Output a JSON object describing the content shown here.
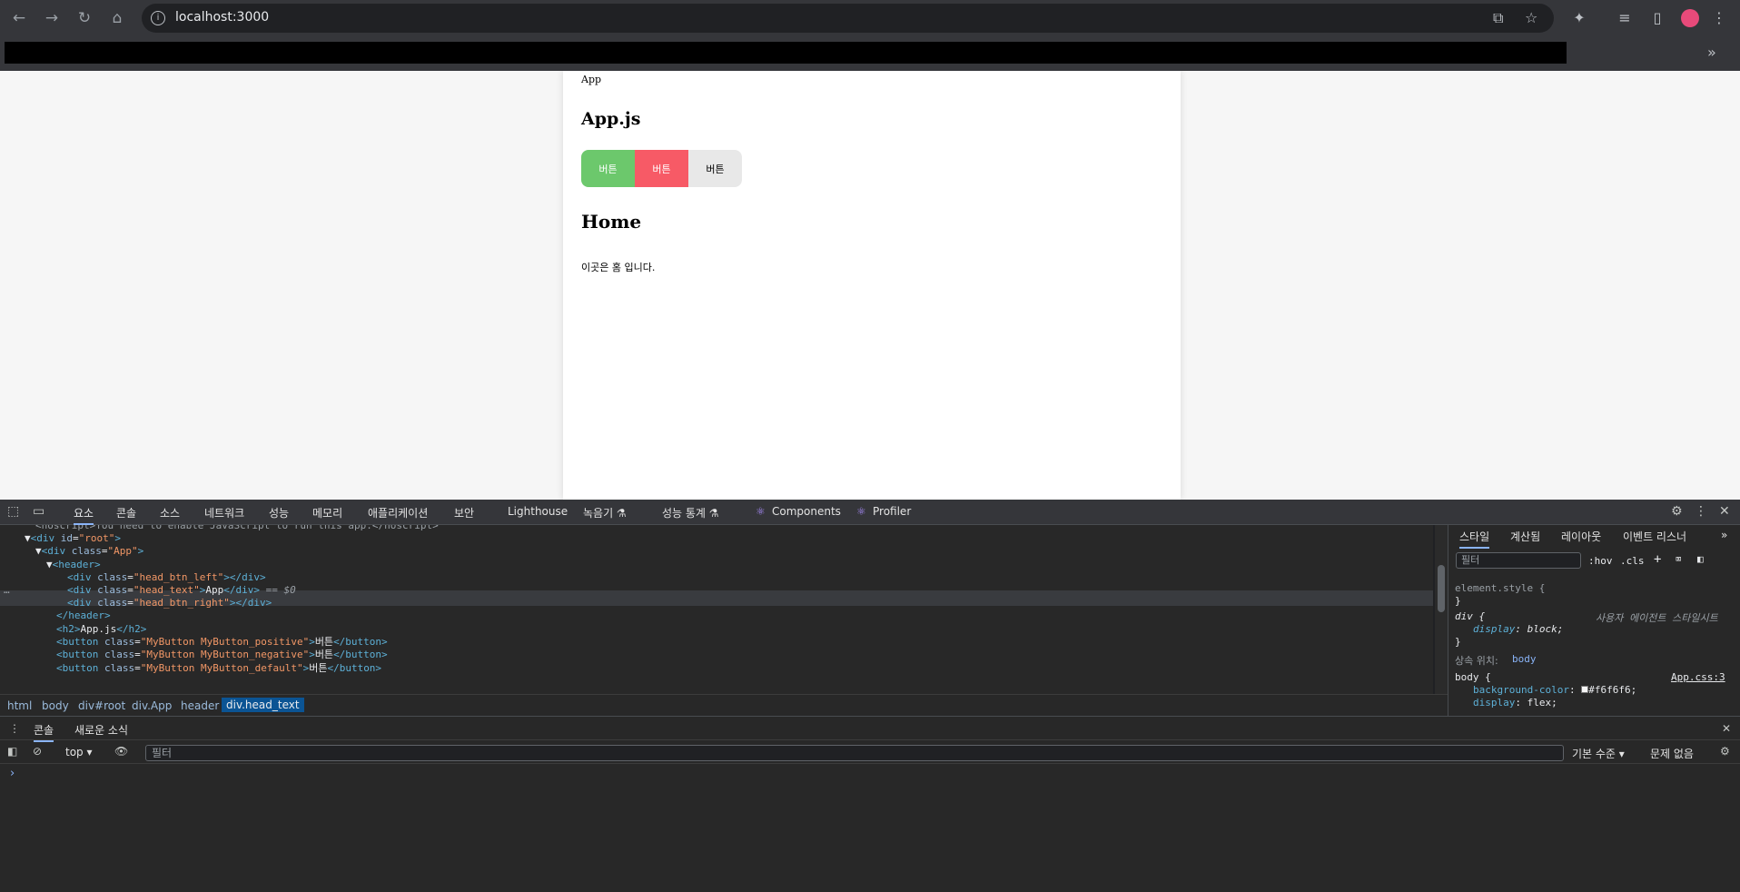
{
  "browser": {
    "url": "localhost:3000",
    "icons": [
      "back-icon",
      "forward-icon",
      "reload-icon",
      "home-icon",
      "info-icon",
      "install-icon",
      "star-icon",
      "extensions-icon",
      "media-icon",
      "sidepanel-icon",
      "profile-avatar",
      "menu-icon"
    ]
  },
  "page": {
    "head_text": "App",
    "title": "App.js",
    "buttons": [
      "버튼",
      "버튼",
      "버튼"
    ],
    "home_title": "Home",
    "home_text": "이곳은 홈 입니다."
  },
  "colors": {
    "positive": "#6cc86c",
    "negative": "#f75a66",
    "default": "#e8e8e8",
    "page_bg": "#f6f6f6",
    "devtools_bg": "#282828",
    "accent": "#8ab4f8"
  },
  "devtools": {
    "tabs": [
      "요소",
      "콘솔",
      "소스",
      "네트워크",
      "성능",
      "메모리",
      "애플리케이션",
      "보안",
      "Lighthouse",
      "녹음기 ⚗",
      "성능 통계 ⚗",
      "Components",
      "Profiler"
    ],
    "tree": {
      "cut": "<noscript>You need to enable JavaScript to run this app.</noscript>",
      "root": {
        "tag": "div",
        "attr": "id",
        "val": "root"
      },
      "app": {
        "tag": "div",
        "attr": "class",
        "val": "App"
      },
      "header": "header",
      "left": {
        "tag": "div",
        "attr": "class",
        "val": "head_btn_left"
      },
      "text": {
        "tag": "div",
        "attr": "class",
        "val": "head_text",
        "content": "App",
        "marker": "== $0"
      },
      "right": {
        "tag": "div",
        "attr": "class",
        "val": "head_btn_right"
      },
      "header_close": "/header",
      "h2": {
        "tag": "h2",
        "content": "App.js"
      },
      "b1": {
        "tag": "button",
        "attr": "class",
        "val": "MyButton MyButton_positive",
        "content": "버튼"
      },
      "b2": {
        "tag": "button",
        "attr": "class",
        "val": "MyButton MyButton_negative",
        "content": "버튼"
      },
      "b3": {
        "tag": "button",
        "attr": "class",
        "val": "MyButton MyButton_default",
        "content": "버튼"
      }
    },
    "breadcrumbs": [
      "html",
      "body",
      "div#root",
      "div.App",
      "header",
      "div.head_text"
    ],
    "styles": {
      "tabs": [
        "스타일",
        "계산됨",
        "레이아웃",
        "이벤트 리스너"
      ],
      "filter_placeholder": "필터",
      "hov": ":hov",
      "cls": ".cls",
      "element_style": "element.style {",
      "close": "}",
      "div_rule": "div {",
      "ua_label": "사용자 에이전트 스타일시트",
      "display_prop": "display",
      "display_val": "block;",
      "inherited_label": "상속 위치:",
      "inherited_from": "body",
      "body_rule": "body {",
      "body_source": "App.css:3",
      "bg_prop": "background-color",
      "bg_val": "#f6f6f6;",
      "display2_prop": "display",
      "display2_val": "flex;"
    },
    "console": {
      "tabs": [
        "콘솔",
        "새로운 소식"
      ],
      "context": "top",
      "filter_placeholder": "필터",
      "level": "기본 수준",
      "issues": "문제 없음"
    }
  }
}
